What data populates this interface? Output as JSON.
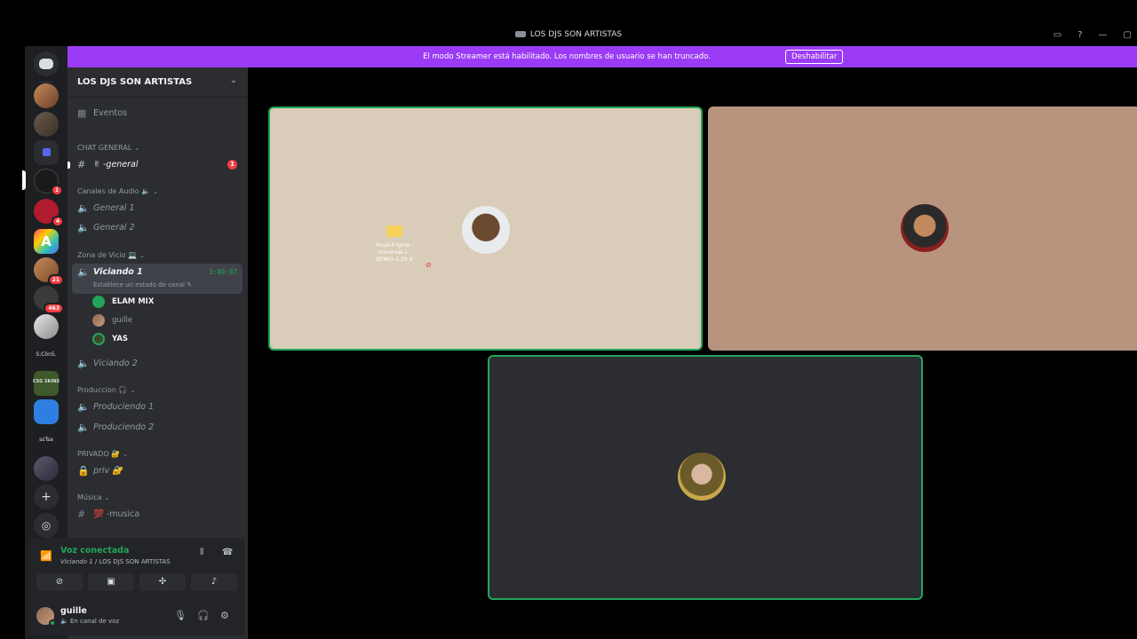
{
  "window": {
    "title": "LOS DJS SON ARTISTAS",
    "icons": [
      "screen-share-icon",
      "help-icon",
      "minimize-icon",
      "maximize-icon"
    ]
  },
  "banner": {
    "message": "El modo Streamer está habilitado. Los nombres de usuario se han truncado.",
    "button": "Deshabilitar",
    "color": "#9b3bf5"
  },
  "server_rail": {
    "badges": [
      "1",
      "4",
      "21",
      "463"
    ],
    "text_labels": [
      "S:Cön5.",
      "CSG SKINS",
      "ssTsa"
    ]
  },
  "sidebar": {
    "server_name": "LOS DJS SON ARTISTAS",
    "events": "Eventos",
    "categories": {
      "chat": "CHAT GENERAL",
      "audio": "Canales de Audio 🔈",
      "vicio": "Zona de Vicio 💻",
      "produccion": "Produccion 🎧",
      "privado": "PRIVADO 🔐",
      "musica": "Música"
    },
    "channels": {
      "general": "✌ -general",
      "general_unread": "1",
      "general1": "General 1",
      "general2": "General 2",
      "viciando1": "Viciando 1",
      "viciando1_timer": "3:00:07",
      "viciando1_status": "Establece un estado de canal ✎",
      "viciando2": "Viciando 2",
      "produciendo1": "Produciendo 1",
      "produciendo2": "Produciendo 2",
      "priv": "priv 🔐",
      "musica": "💯 -musica"
    },
    "members": [
      "ELAM MIX",
      "guille",
      "YAS"
    ]
  },
  "voice": {
    "status": "Voz conectada",
    "channel": "Viciando 1",
    "server": " / LOS DJS SON ARTISTAS",
    "buttons": [
      "camera-off-icon",
      "screen-share-icon",
      "activities-icon",
      "soundboard-icon"
    ]
  },
  "user": {
    "name": "guille",
    "status": "🔈 En canal de voz"
  },
  "stage": {
    "tiles": [
      {
        "bg": "#d9ccb8",
        "speaking": true
      },
      {
        "bg": "#b8937d",
        "speaking": false
      },
      {
        "bg": "#2b2d31",
        "speaking": true
      }
    ],
    "desktop_file": "Focal-Engine -Universal-1.-BEMIO-1.20.d"
  },
  "colors": {
    "accent_green": "#23a55a",
    "unread_red": "#f23f43"
  }
}
